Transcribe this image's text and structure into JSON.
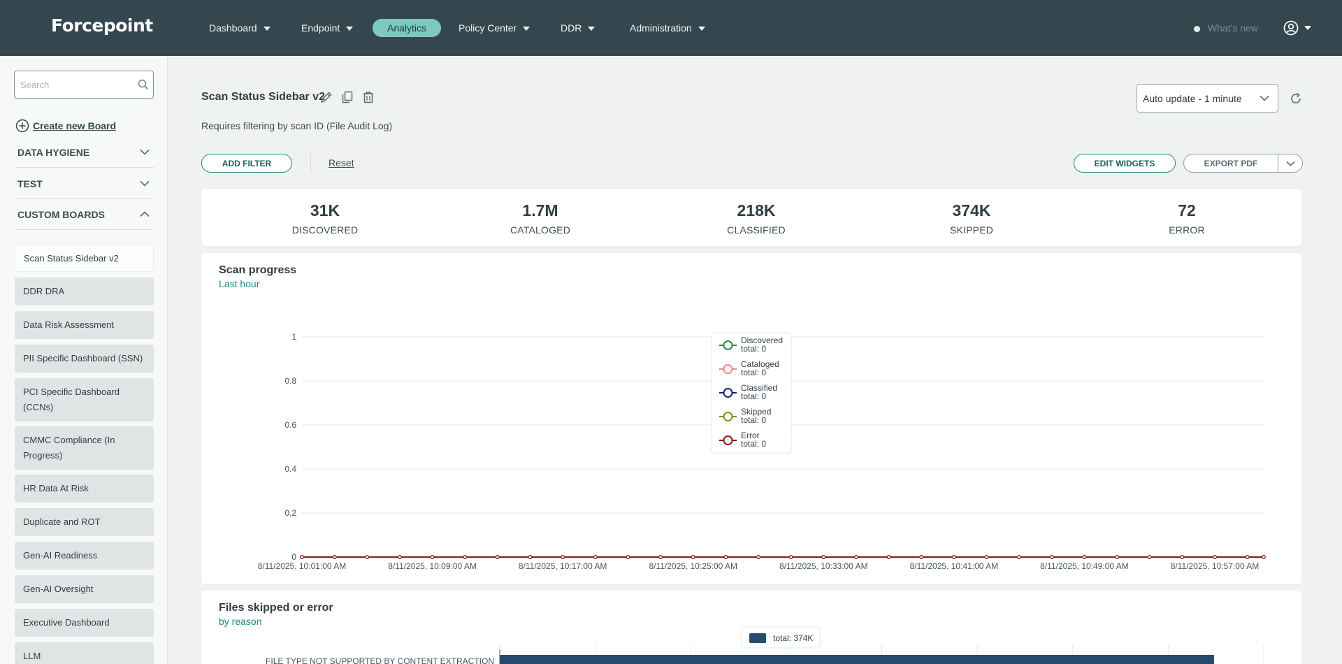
{
  "app": {
    "logo": "Forcepoint",
    "nav": [
      {
        "label": "Dashboard"
      },
      {
        "label": "Endpoint"
      },
      {
        "label": "Analytics"
      },
      {
        "label": "Policy Center"
      },
      {
        "label": "DDR"
      },
      {
        "label": "Administration"
      }
    ],
    "active_nav": "Analytics",
    "whats_new": "What's new"
  },
  "sidebar": {
    "search_placeholder": "Search",
    "create_board": "Create new Board",
    "sections": [
      {
        "label": "DATA HYGIENE",
        "expanded": false
      },
      {
        "label": "TEST",
        "expanded": false
      },
      {
        "label": "CUSTOM BOARDS",
        "expanded": true
      }
    ],
    "boards": [
      {
        "label": "Scan Status Sidebar v2"
      },
      {
        "label": "DDR DRA"
      },
      {
        "label": "Data Risk Assessment"
      },
      {
        "label": "PII Specific Dashboard (SSN)"
      },
      {
        "label": "PCI Specific Dashboard (CCNs)"
      },
      {
        "label": "CMMC Compliance (In Progress)"
      },
      {
        "label": "HR Data At Risk"
      },
      {
        "label": "Duplicate and ROT"
      },
      {
        "label": "Gen-AI Readiness"
      },
      {
        "label": "Gen-AI Oversight"
      },
      {
        "label": "Executive Dashboard"
      },
      {
        "label": "LLM"
      }
    ]
  },
  "board": {
    "title": "Scan Status Sidebar v2",
    "description": "Requires filtering by scan ID (File Audit Log)",
    "auto_update": "Auto update - 1 minute",
    "add_filter": "ADD FILTER",
    "reset": "Reset",
    "edit_widgets": "EDIT WIDGETS",
    "export_pdf": "EXPORT PDF"
  },
  "stats": [
    {
      "value": "31K",
      "label": "DISCOVERED"
    },
    {
      "value": "1.7M",
      "label": "CATALOGED"
    },
    {
      "value": "218K",
      "label": "CLASSIFIED"
    },
    {
      "value": "374K",
      "label": "SKIPPED"
    },
    {
      "value": "72",
      "label": "ERROR"
    }
  ],
  "scan_progress": {
    "title": "Scan progress",
    "subtitle": "Last hour"
  },
  "files_skipped": {
    "title": "Files skipped or error",
    "subtitle": "by reason"
  },
  "chart_data": [
    {
      "type": "line",
      "title": "Scan progress",
      "subtitle": "Last hour",
      "ylim": [
        0,
        1
      ],
      "y_ticks": [
        "0",
        "0.2",
        "0.4",
        "0.6",
        "0.8",
        "1"
      ],
      "x_tick_labels": [
        "8/11/2025, 10:01:00 AM",
        "8/11/2025, 10:09:00 AM",
        "8/11/2025, 10:17:00 AM",
        "8/11/2025, 10:25:00 AM",
        "8/11/2025, 10:33:00 AM",
        "8/11/2025, 10:41:00 AM",
        "8/11/2025, 10:49:00 AM",
        "8/11/2025, 10:57:00 AM"
      ],
      "point_count": 60,
      "grid": true,
      "legend_position": "top-center",
      "series": [
        {
          "name": "Discovered",
          "total_label": "total: 0",
          "color": "#2e8b4a",
          "value": 0
        },
        {
          "name": "Cataloged",
          "total_label": "total: 0",
          "color": "#f08b8b",
          "value": 0
        },
        {
          "name": "Classified",
          "total_label": "total: 0",
          "color": "#1c1f7a",
          "value": 0
        },
        {
          "name": "Skipped",
          "total_label": "total: 0",
          "color": "#8a8a1a",
          "value": 0
        },
        {
          "name": "Error",
          "total_label": "total: 0",
          "color": "#8b1a1a",
          "value": 0
        }
      ]
    },
    {
      "type": "bar",
      "orientation": "horizontal",
      "title": "Files skipped or error",
      "subtitle": "by reason",
      "categories": [
        "FILE TYPE NOT SUPPORTED BY CONTENT EXTRACTION"
      ],
      "series": [
        {
          "name": "total: 374K",
          "color": "#274b6e",
          "values": [
            374000
          ]
        }
      ],
      "xlim": [
        0,
        400000
      ],
      "legend_position": "top-center"
    }
  ]
}
